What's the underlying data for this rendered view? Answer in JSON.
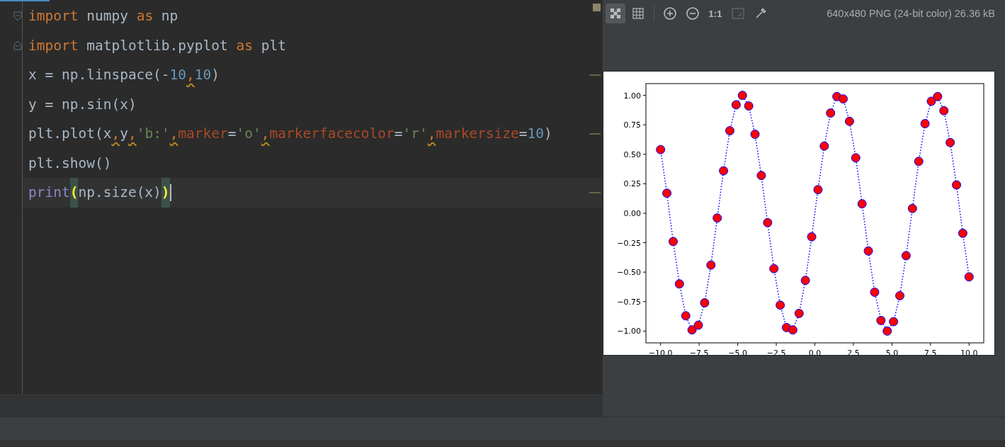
{
  "editor": {
    "lines": [
      {
        "kind": "fold-start",
        "current": false,
        "warning": false,
        "tokens": [
          {
            "kind": "kw",
            "text": "import"
          },
          {
            "kind": "id",
            "text": " numpy "
          },
          {
            "kind": "kw",
            "text": "as"
          },
          {
            "kind": "id",
            "text": " np"
          }
        ]
      },
      {
        "kind": "fold-end",
        "current": false,
        "warning": false,
        "tokens": [
          {
            "kind": "kw",
            "text": "import"
          },
          {
            "kind": "id",
            "text": " matplotlib.pyplot "
          },
          {
            "kind": "kw",
            "text": "as"
          },
          {
            "kind": "id",
            "text": " plt"
          }
        ]
      },
      {
        "kind": "plain",
        "current": false,
        "warning": true,
        "tokens": [
          {
            "kind": "id",
            "text": "x = np.linspace(-"
          },
          {
            "kind": "num",
            "text": "10"
          },
          {
            "kind": "comma",
            "text": ","
          },
          {
            "kind": "num",
            "text": "10"
          },
          {
            "kind": "id",
            "text": ")"
          }
        ]
      },
      {
        "kind": "plain",
        "current": false,
        "warning": false,
        "tokens": [
          {
            "kind": "id",
            "text": "y = np.sin(x)"
          }
        ]
      },
      {
        "kind": "plain",
        "current": false,
        "warning": true,
        "tokens": [
          {
            "kind": "id",
            "text": "plt.plot(x"
          },
          {
            "kind": "comma",
            "text": ","
          },
          {
            "kind": "id",
            "text": "y"
          },
          {
            "kind": "comma",
            "text": ","
          },
          {
            "kind": "str",
            "text": "'b:'"
          },
          {
            "kind": "comma",
            "text": ","
          },
          {
            "kind": "param",
            "text": "marker"
          },
          {
            "kind": "id",
            "text": "="
          },
          {
            "kind": "str",
            "text": "'o'"
          },
          {
            "kind": "comma",
            "text": ","
          },
          {
            "kind": "param",
            "text": "markerfacecolor"
          },
          {
            "kind": "id",
            "text": "="
          },
          {
            "kind": "str",
            "text": "'r'"
          },
          {
            "kind": "comma",
            "text": ","
          },
          {
            "kind": "param",
            "text": "markersize"
          },
          {
            "kind": "id",
            "text": "="
          },
          {
            "kind": "num",
            "text": "10"
          },
          {
            "kind": "id",
            "text": ")"
          }
        ]
      },
      {
        "kind": "plain",
        "current": false,
        "warning": false,
        "tokens": [
          {
            "kind": "id",
            "text": "plt.show()"
          }
        ]
      },
      {
        "kind": "plain",
        "current": true,
        "warning": true,
        "tokens": [
          {
            "kind": "builtin",
            "text": "print"
          },
          {
            "kind": "match",
            "text": "("
          },
          {
            "kind": "id",
            "text": "np.size(x)"
          },
          {
            "kind": "match",
            "text": ")"
          }
        ]
      }
    ]
  },
  "viewer": {
    "toolbar": [
      {
        "kind": "checker",
        "selected": true,
        "disabled": false
      },
      {
        "kind": "grid",
        "selected": false,
        "disabled": false
      },
      {
        "kind": "sep"
      },
      {
        "kind": "zoom-in",
        "selected": false,
        "disabled": false
      },
      {
        "kind": "zoom-out",
        "selected": false,
        "disabled": false
      },
      {
        "kind": "text",
        "text": "1:1",
        "selected": false,
        "disabled": false
      },
      {
        "kind": "fit",
        "selected": false,
        "disabled": true
      },
      {
        "kind": "picker",
        "selected": false,
        "disabled": false
      }
    ],
    "info": "640x480 PNG (24-bit color) 26.36 kB",
    "image": {
      "chart_data": {
        "type": "line",
        "x": [
          -10,
          -9.592,
          -9.184,
          -8.776,
          -8.367,
          -7.959,
          -7.551,
          -7.143,
          -6.735,
          -6.327,
          -5.918,
          -5.51,
          -5.102,
          -4.694,
          -4.286,
          -3.878,
          -3.469,
          -3.061,
          -2.653,
          -2.245,
          -1.837,
          -1.429,
          -1.02,
          -0.612,
          -0.204,
          0.204,
          0.612,
          1.02,
          1.429,
          1.837,
          2.245,
          2.653,
          3.061,
          3.469,
          3.878,
          4.286,
          4.694,
          5.102,
          5.51,
          5.918,
          6.327,
          6.735,
          7.143,
          7.551,
          7.959,
          8.367,
          8.776,
          9.184,
          9.592,
          10
        ],
        "series": [
          {
            "color": "#0000ff",
            "line_style": "dotted",
            "marker": "o",
            "values": [
              0.54,
              0.17,
              -0.24,
              -0.6,
              -0.87,
              -0.99,
              -0.95,
              -0.76,
              -0.44,
              -0.04,
              0.36,
              0.7,
              0.92,
              1,
              0.91,
              0.67,
              0.32,
              -0.08,
              -0.47,
              -0.78,
              -0.97,
              -0.99,
              -0.85,
              -0.57,
              -0.2,
              0.2,
              0.57,
              0.85,
              0.99,
              0.97,
              0.78,
              0.47,
              0.08,
              -0.32,
              -0.67,
              -0.91,
              -1,
              -0.92,
              -0.7,
              -0.36,
              0.04,
              0.44,
              0.76,
              0.95,
              0.99,
              0.87,
              0.6,
              0.24,
              -0.17,
              -0.54
            ]
          }
        ],
        "xlim": [
          -10.95,
          10.95
        ],
        "ylim": [
          -1.1,
          1.1
        ],
        "xticks": [
          {
            "value": -10,
            "label": "−10.0"
          },
          {
            "value": -7.5,
            "label": "−7.5"
          },
          {
            "value": -5,
            "label": "−5.0"
          },
          {
            "value": -2.5,
            "label": "−2.5"
          },
          {
            "value": 0,
            "label": "0.0"
          },
          {
            "value": 2.5,
            "label": "2.5"
          },
          {
            "value": 5,
            "label": "5.0"
          },
          {
            "value": 7.5,
            "label": "7.5"
          },
          {
            "value": 10,
            "label": "10.0"
          }
        ],
        "yticks": [
          {
            "value": 1,
            "label": "1.00"
          },
          {
            "value": 0.75,
            "label": "0.75"
          },
          {
            "value": 0.5,
            "label": "0.50"
          },
          {
            "value": 0.25,
            "label": "0.25"
          },
          {
            "value": 0,
            "label": "0.00"
          },
          {
            "value": -0.25,
            "label": "−0.25"
          },
          {
            "value": -0.5,
            "label": "−0.50"
          },
          {
            "value": -0.75,
            "label": "−0.75"
          },
          {
            "value": -1,
            "label": "−1.00"
          }
        ]
      }
    }
  }
}
